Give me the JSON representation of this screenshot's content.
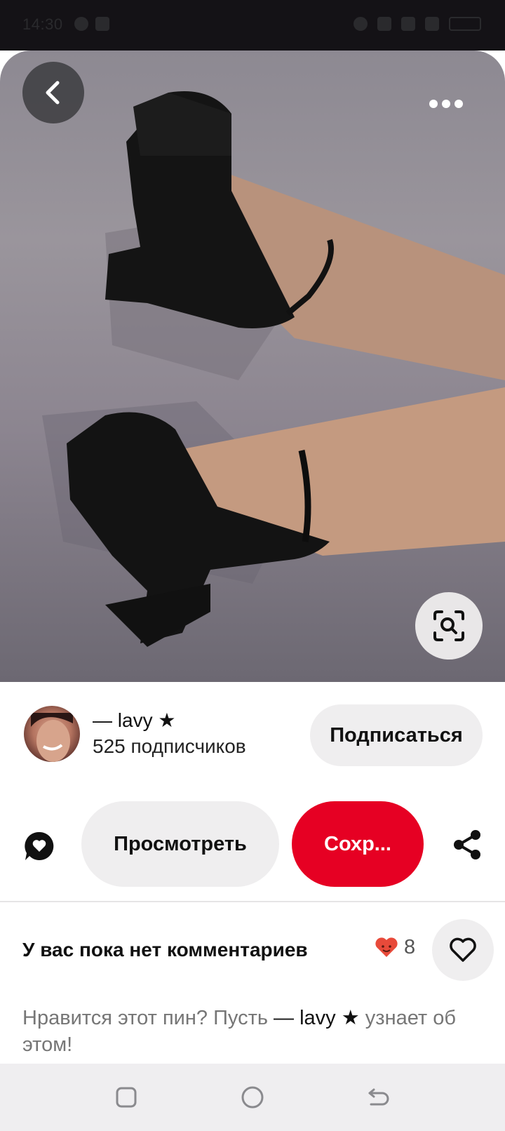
{
  "status_bar": {
    "time": "14:30",
    "icons": [
      "owl-icon",
      "notification-icon",
      "alarm-icon",
      "wifi-icon",
      "signal-icon",
      "network-type-icon",
      "battery-icon"
    ]
  },
  "pin": {
    "image_icon": "photo-black-platform-heels",
    "back_icon": "chevron-left-icon",
    "more_icon": "more-dots-icon",
    "lens_icon": "visual-search-icon"
  },
  "creator": {
    "name": "— lavy ★",
    "followers": "525 подписчиков",
    "follow_label": "Подписаться"
  },
  "actions": {
    "comment_icon": "comment-heart-icon",
    "view_label": "Просмотреть",
    "save_label": "Сохр...",
    "share_icon": "share-icon",
    "save_color": "#e60023"
  },
  "comments": {
    "title": "У вас пока нет комментариев",
    "reaction_count": "8",
    "prompt_before": "Нравится этот пин? Пусть ",
    "prompt_name": "— lavy ★",
    "prompt_after": " узнает об этом!"
  },
  "navbar": {
    "icons": [
      "recent-apps-icon",
      "home-icon",
      "back-icon"
    ]
  }
}
